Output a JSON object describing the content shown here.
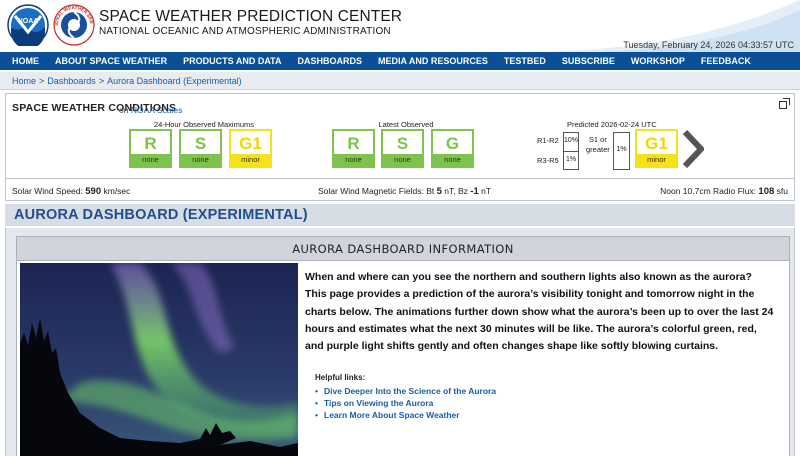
{
  "header": {
    "title": "SPACE WEATHER PREDICTION CENTER",
    "subtitle": "NATIONAL OCEANIC AND ATMOSPHERIC ADMINISTRATION",
    "datetime": "Tuesday, February 24, 2026 04:33:57 UTC",
    "noaa_logo_text": "NOAA",
    "nws_logo_text": "NATIONAL WEATHER SERVICE"
  },
  "nav": {
    "items": [
      "HOME",
      "ABOUT SPACE WEATHER",
      "PRODUCTS AND DATA",
      "DASHBOARDS",
      "MEDIA AND RESOURCES",
      "TESTBED",
      "SUBSCRIBE",
      "WORKSHOP",
      "FEEDBACK"
    ]
  },
  "breadcrumb": {
    "items": [
      "Home",
      "Dashboards",
      "Aurora Dashboard (Experimental)"
    ],
    "separator": ">"
  },
  "conditions": {
    "title": "SPACE WEATHER CONDITIONS",
    "on_text": "on",
    "on_link": "NOAA Scales",
    "observed_24h": {
      "label": "24-Hour Observed Maximums",
      "scales": [
        {
          "letter": "R",
          "level": "none",
          "color": "#7fc24e"
        },
        {
          "letter": "S",
          "level": "none",
          "color": "#7fc24e"
        },
        {
          "letter": "G1",
          "level": "minor",
          "color": "#f4e21a"
        }
      ]
    },
    "latest": {
      "label": "Latest Observed",
      "scales": [
        {
          "letter": "R",
          "level": "none",
          "color": "#7fc24e"
        },
        {
          "letter": "S",
          "level": "none",
          "color": "#7fc24e"
        },
        {
          "letter": "G",
          "level": "none",
          "color": "#7fc24e"
        }
      ]
    },
    "predicted": {
      "label": "Predicted 2026-02-24 UTC",
      "r1r2_label": "R1-R2",
      "r1r2_pct": "10%",
      "r3r5_label": "R3-R5",
      "r3r5_pct": "1%",
      "s1_label_1": "S1 or",
      "s1_label_2": "greater",
      "s1_pct": "1%",
      "g_letter": "G1",
      "g_level": "minor"
    },
    "solar_wind_speed": {
      "label": "Solar Wind Speed:",
      "value": "590",
      "unit": "km/sec"
    },
    "magnetic_fields": {
      "label": "Solar Wind Magnetic Fields:",
      "bt_label": "Bt",
      "bt_value": "5",
      "bt_unit": "nT,",
      "bz_label": "Bz",
      "bz_value": "-1",
      "bz_unit": "nT"
    },
    "radio_flux": {
      "label": "Noon 10.7cm Radio Flux:",
      "value": "108",
      "unit": "sfu"
    }
  },
  "page_title": "AURORA DASHBOARD (EXPERIMENTAL)",
  "info": {
    "header": "AURORA DASHBOARD INFORMATION",
    "body": "When and where can you see the northern and southern lights also known as the aurora? This page provides a prediction of the aurora’s visibility tonight and tomorrow night in the charts below. The animations further down show what the aurora’s been up to over the last 24 hours and estimates what the next 30 minutes will be like. The aurora’s colorful green, red, and purple light shifts gently and often changes shape like softly blowing curtains.",
    "helpful_label": "Helpful links:",
    "links": [
      "Dive Deeper Into the Science of the Aurora",
      "Tips on Viewing the Aurora",
      "Learn More About Space Weather"
    ]
  }
}
